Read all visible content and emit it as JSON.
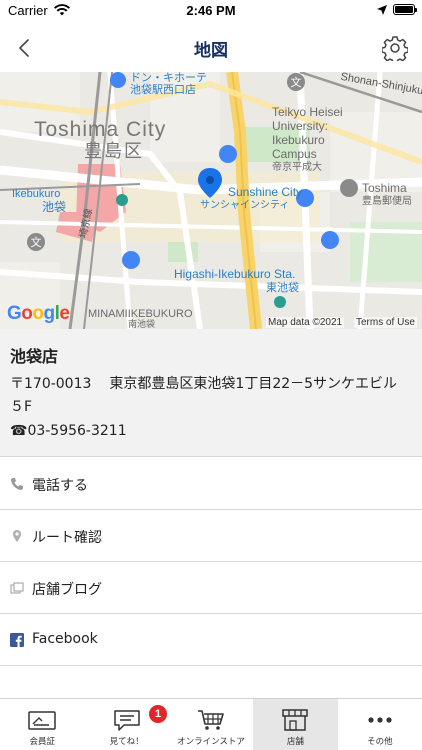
{
  "status_bar": {
    "carrier": "Carrier",
    "time": "2:46 PM"
  },
  "nav": {
    "title": "地図"
  },
  "map": {
    "labels": {
      "donki_1": "ドン・キホーテ",
      "donki_2": "池袋駅西口店",
      "toshima_city": "Toshima City",
      "toshima_ku": "豊島区",
      "ikebukuro_en": "Ikebukuro",
      "ikebukuro_jp": "池袋",
      "saikyo_line": "埼京線",
      "teikyo_1": "Teikyo Heisei",
      "teikyo_2": "University:",
      "teikyo_3": "Ikebukuro",
      "teikyo_4": "Campus",
      "teikyo_5": "帝京平成大",
      "shonan": "Shonan-Shinjuku",
      "sunshine_en": "Sunshine City",
      "sunshine_jp": "サンシャインシティ",
      "toshima_post_1": "Toshima",
      "toshima_post_2": "豊島郵便局",
      "higashi_1": "Higashi-Ikebukuro Sta.",
      "higashi_2": "東池袋",
      "minamiikebukuro": "MINAMIIKEBUKURO",
      "minamiikebukuro_jp": "南池袋"
    },
    "attribution": "Map data ©2021",
    "terms": "Terms of Use",
    "google_letters": [
      "G",
      "o",
      "o",
      "g",
      "l",
      "e"
    ]
  },
  "store": {
    "name": "池袋店",
    "zip": "〒170-0013",
    "address": "東京都豊島区東池袋1丁目22－5サンケエビル５F",
    "phone": "☎03-5956-3211"
  },
  "actions": [
    {
      "label": "電話する",
      "icon": "phone-icon"
    },
    {
      "label": "ルート確認",
      "icon": "map-pin-icon"
    },
    {
      "label": "店舗ブログ",
      "icon": "blog-icon"
    },
    {
      "label": "Facebook",
      "icon": "facebook-icon"
    }
  ],
  "tabs": [
    {
      "label": "会員証",
      "icon": "member-card-icon"
    },
    {
      "label": "見てね！",
      "icon": "message-icon",
      "badge": "1"
    },
    {
      "label": "オンラインストア",
      "icon": "cart-icon"
    },
    {
      "label": "店舗",
      "icon": "store-icon",
      "active": true
    },
    {
      "label": "その他",
      "icon": "more-icon"
    }
  ],
  "colors": {
    "nav_title": "#1a3060",
    "badge": "#e0262b",
    "map_pin": "#1a73e8",
    "facebook": "#3b5998",
    "tab_active_bg": "#e6e6e6"
  }
}
